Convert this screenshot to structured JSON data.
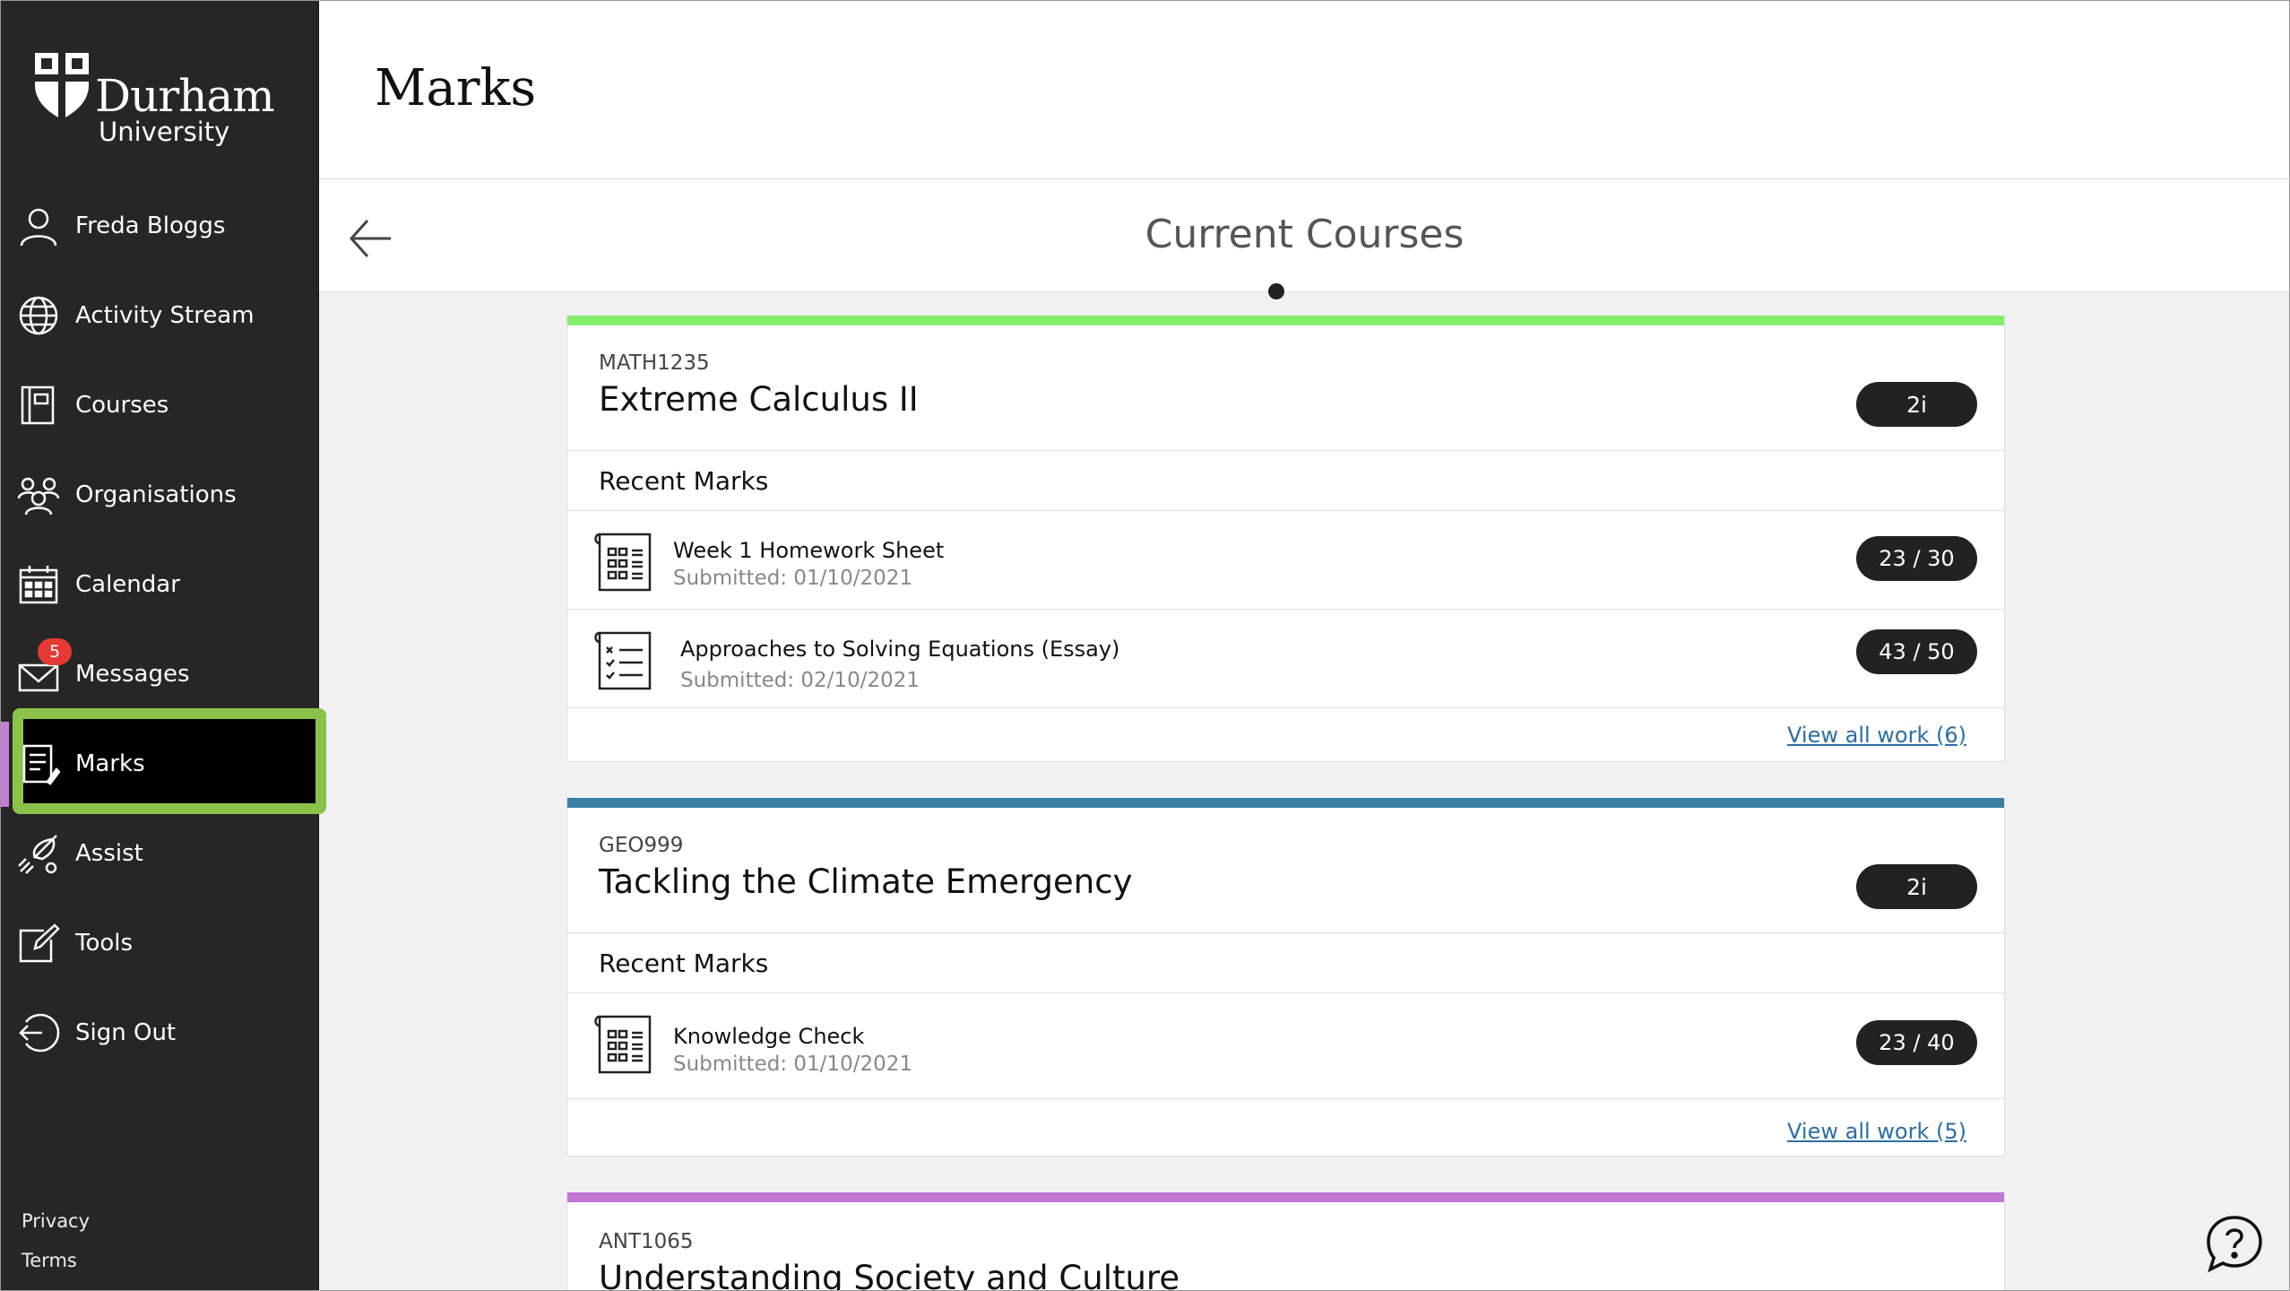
{
  "brand": {
    "name": "Durham",
    "sub": "University"
  },
  "sidebar": {
    "items": [
      {
        "label": "Freda Bloggs",
        "icon": "user-icon"
      },
      {
        "label": "Activity Stream",
        "icon": "globe-icon"
      },
      {
        "label": "Courses",
        "icon": "book-icon"
      },
      {
        "label": "Organisations",
        "icon": "people-icon"
      },
      {
        "label": "Calendar",
        "icon": "calendar-icon"
      },
      {
        "label": "Messages",
        "icon": "envelope-icon",
        "badge": "5"
      },
      {
        "label": "Marks",
        "icon": "marks-icon",
        "active": true
      },
      {
        "label": "Assist",
        "icon": "rocket-icon"
      },
      {
        "label": "Tools",
        "icon": "edit-icon"
      },
      {
        "label": "Sign Out",
        "icon": "sign-out-icon"
      }
    ],
    "footer": {
      "privacy": "Privacy",
      "terms": "Terms"
    }
  },
  "header": {
    "title": "Marks"
  },
  "subheader": {
    "title": "Current Courses"
  },
  "courses": [
    {
      "code": "MATH1235",
      "name": "Extreme Calculus II",
      "grade": "2i",
      "color": "#86ee6e",
      "recent_label": "Recent Marks",
      "marks": [
        {
          "title": "Week 1 Homework Sheet",
          "submitted": "Submitted: 01/10/2021",
          "score": "23 / 30",
          "icon": "grid-sheet-icon"
        },
        {
          "title": "Approaches to Solving Equations (Essay)",
          "submitted": "Submitted: 02/10/2021",
          "score": "43 / 50",
          "icon": "checklist-icon"
        }
      ],
      "view_all": "View all work (6)"
    },
    {
      "code": "GEO999",
      "name": "Tackling the Climate Emergency",
      "grade": "2i",
      "color": "#3a7ea4",
      "recent_label": "Recent Marks",
      "marks": [
        {
          "title": "Knowledge Check",
          "submitted": "Submitted: 01/10/2021",
          "score": "23 / 40",
          "icon": "grid-sheet-icon"
        }
      ],
      "view_all": "View all work (5)"
    },
    {
      "code": "ANT1065",
      "name": "Understanding Society and Culture",
      "color": "#c277d6"
    }
  ]
}
